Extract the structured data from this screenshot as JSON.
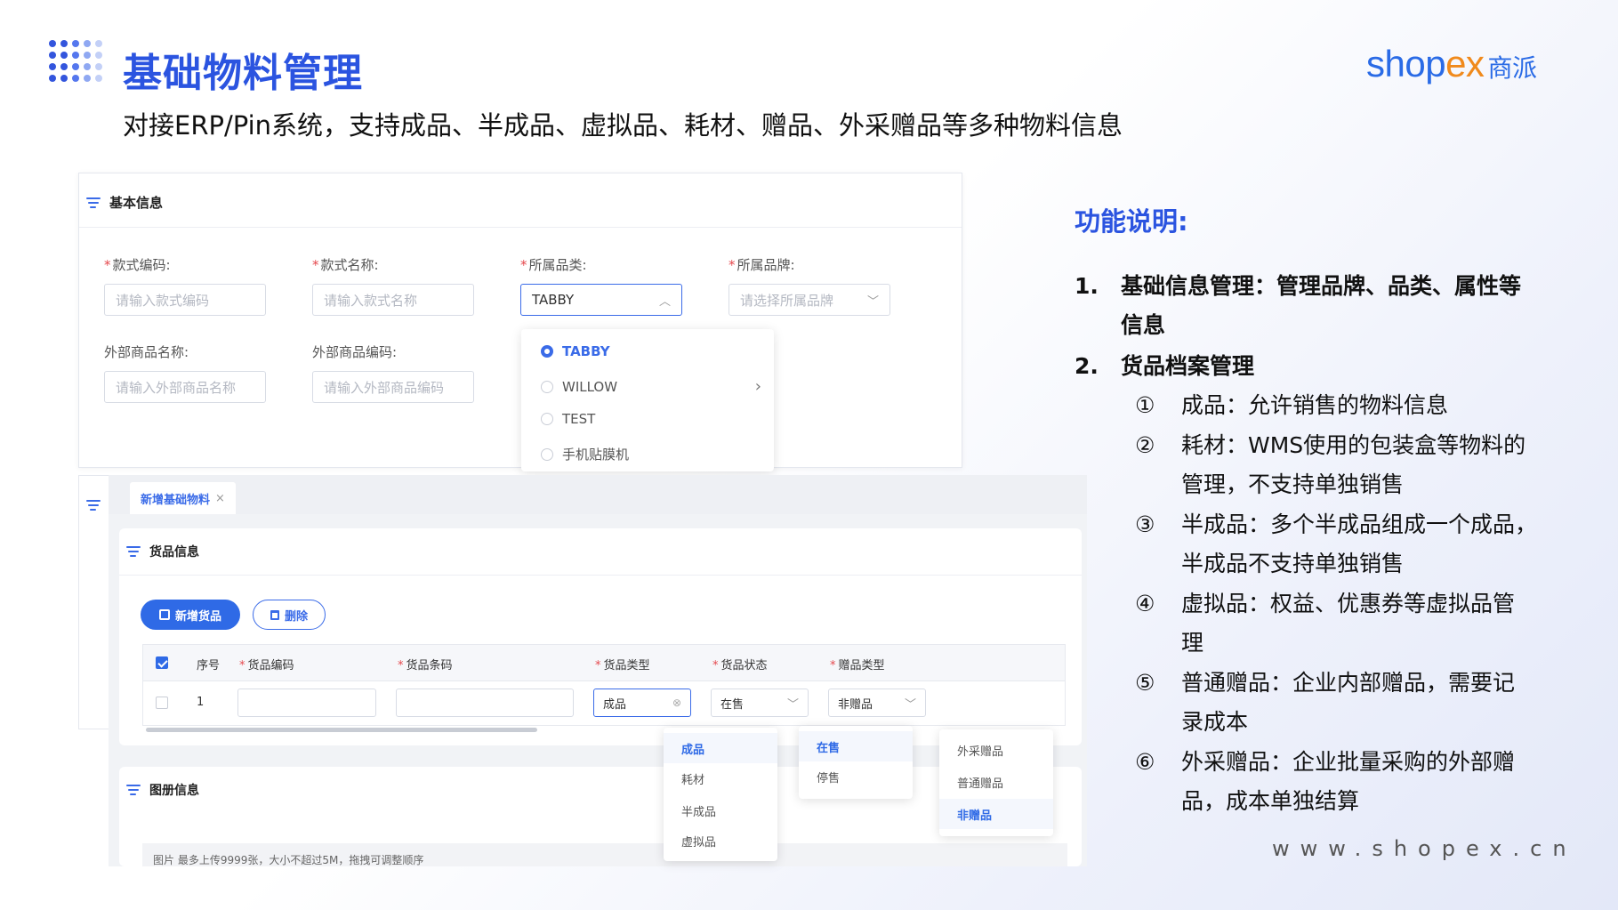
{
  "header": {
    "title": "基础物料管理",
    "subtitle": "对接ERP/Pin系统，支持成品、半成品、虚拟品、耗材、赠品、外采赠品等多种物料信息",
    "logo_text": "shop",
    "logo_x": "ex",
    "logo_cn": "商派",
    "website": "www.shopex.cn"
  },
  "colors": {
    "accent": "#2b54e0",
    "primary_button": "#2f6ae6",
    "logo_orange": "#f08a1c",
    "required": "#e5484d"
  },
  "basic_info": {
    "section_title": "基本信息",
    "fields": [
      {
        "label": "款式编码:",
        "required": true,
        "placeholder": "请输入款式编码"
      },
      {
        "label": "款式名称:",
        "required": true,
        "placeholder": "请输入款式名称"
      },
      {
        "label": "所属品类:",
        "required": true,
        "value": "TABBY"
      },
      {
        "label": "所属品牌:",
        "required": true,
        "placeholder": "请选择所属品牌"
      },
      {
        "label": "外部商品名称:",
        "required": false,
        "placeholder": "请输入外部商品名称"
      },
      {
        "label": "外部商品编码:",
        "required": false,
        "placeholder": "请输入外部商品编码"
      }
    ],
    "category_options": [
      "TABBY",
      "WILLOW",
      "TEST",
      "手机贴膜机"
    ],
    "category_selected": "TABBY"
  },
  "material_form": {
    "tab_label": "新增基础物料",
    "tab_close": "×",
    "goods_section": "货品信息",
    "add_button": "新增货品",
    "delete_button": "删除",
    "columns": [
      "序号",
      "货品编码",
      "货品条码",
      "货品类型",
      "货品状态",
      "赠品类型"
    ],
    "row": {
      "index": "1",
      "code": "",
      "barcode": "",
      "type": "成品",
      "status": "在售",
      "gift_type": "非赠品"
    },
    "type_options": [
      "成品",
      "耗材",
      "半成品",
      "虚拟品"
    ],
    "status_options": [
      "在售",
      "停售"
    ],
    "gift_options": [
      "外采赠品",
      "普通赠品",
      "非赠品"
    ],
    "album_section": "图册信息",
    "album_hint": "图片 最多上传9999张，大小不超过5M，拖拽可调整顺序"
  },
  "features": {
    "title": "功能说明:",
    "items": [
      {
        "num": "1.",
        "lines": [
          "基础信息管理：管理品牌、品类、属性等",
          "信息"
        ]
      },
      {
        "num": "2.",
        "lines": [
          "货品档案管理"
        ]
      }
    ],
    "sub_items": [
      {
        "mark": "①",
        "lines": [
          "成品：允许销售的物料信息"
        ]
      },
      {
        "mark": "②",
        "lines": [
          "耗材：WMS使用的包装盒等物料的",
          "管理，不支持单独销售"
        ]
      },
      {
        "mark": "③",
        "lines": [
          "半成品：多个半成品组成一个成品，",
          "半成品不支持单独销售"
        ]
      },
      {
        "mark": "④",
        "lines": [
          "虚拟品：权益、优惠券等虚拟品管",
          "理"
        ]
      },
      {
        "mark": "⑤",
        "lines": [
          "普通赠品：企业内部赠品，需要记",
          "录成本"
        ]
      },
      {
        "mark": "⑥",
        "lines": [
          "外采赠品：企业批量采购的外部赠",
          "品，成本单独结算"
        ]
      }
    ]
  }
}
